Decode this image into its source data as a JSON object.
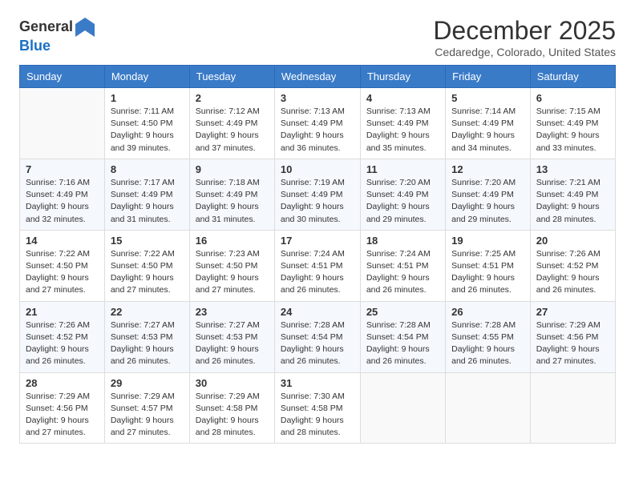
{
  "header": {
    "logo_line1": "General",
    "logo_line2": "Blue",
    "month_title": "December 2025",
    "location": "Cedaredge, Colorado, United States"
  },
  "weekdays": [
    "Sunday",
    "Monday",
    "Tuesday",
    "Wednesday",
    "Thursday",
    "Friday",
    "Saturday"
  ],
  "weeks": [
    [
      {
        "day": "",
        "sunrise": "",
        "sunset": "",
        "daylight": ""
      },
      {
        "day": "1",
        "sunrise": "7:11 AM",
        "sunset": "4:50 PM",
        "daylight": "9 hours and 39 minutes."
      },
      {
        "day": "2",
        "sunrise": "7:12 AM",
        "sunset": "4:49 PM",
        "daylight": "9 hours and 37 minutes."
      },
      {
        "day": "3",
        "sunrise": "7:13 AM",
        "sunset": "4:49 PM",
        "daylight": "9 hours and 36 minutes."
      },
      {
        "day": "4",
        "sunrise": "7:13 AM",
        "sunset": "4:49 PM",
        "daylight": "9 hours and 35 minutes."
      },
      {
        "day": "5",
        "sunrise": "7:14 AM",
        "sunset": "4:49 PM",
        "daylight": "9 hours and 34 minutes."
      },
      {
        "day": "6",
        "sunrise": "7:15 AM",
        "sunset": "4:49 PM",
        "daylight": "9 hours and 33 minutes."
      }
    ],
    [
      {
        "day": "7",
        "sunrise": "7:16 AM",
        "sunset": "4:49 PM",
        "daylight": "9 hours and 32 minutes."
      },
      {
        "day": "8",
        "sunrise": "7:17 AM",
        "sunset": "4:49 PM",
        "daylight": "9 hours and 31 minutes."
      },
      {
        "day": "9",
        "sunrise": "7:18 AM",
        "sunset": "4:49 PM",
        "daylight": "9 hours and 31 minutes."
      },
      {
        "day": "10",
        "sunrise": "7:19 AM",
        "sunset": "4:49 PM",
        "daylight": "9 hours and 30 minutes."
      },
      {
        "day": "11",
        "sunrise": "7:20 AM",
        "sunset": "4:49 PM",
        "daylight": "9 hours and 29 minutes."
      },
      {
        "day": "12",
        "sunrise": "7:20 AM",
        "sunset": "4:49 PM",
        "daylight": "9 hours and 29 minutes."
      },
      {
        "day": "13",
        "sunrise": "7:21 AM",
        "sunset": "4:49 PM",
        "daylight": "9 hours and 28 minutes."
      }
    ],
    [
      {
        "day": "14",
        "sunrise": "7:22 AM",
        "sunset": "4:50 PM",
        "daylight": "9 hours and 27 minutes."
      },
      {
        "day": "15",
        "sunrise": "7:22 AM",
        "sunset": "4:50 PM",
        "daylight": "9 hours and 27 minutes."
      },
      {
        "day": "16",
        "sunrise": "7:23 AM",
        "sunset": "4:50 PM",
        "daylight": "9 hours and 27 minutes."
      },
      {
        "day": "17",
        "sunrise": "7:24 AM",
        "sunset": "4:51 PM",
        "daylight": "9 hours and 26 minutes."
      },
      {
        "day": "18",
        "sunrise": "7:24 AM",
        "sunset": "4:51 PM",
        "daylight": "9 hours and 26 minutes."
      },
      {
        "day": "19",
        "sunrise": "7:25 AM",
        "sunset": "4:51 PM",
        "daylight": "9 hours and 26 minutes."
      },
      {
        "day": "20",
        "sunrise": "7:26 AM",
        "sunset": "4:52 PM",
        "daylight": "9 hours and 26 minutes."
      }
    ],
    [
      {
        "day": "21",
        "sunrise": "7:26 AM",
        "sunset": "4:52 PM",
        "daylight": "9 hours and 26 minutes."
      },
      {
        "day": "22",
        "sunrise": "7:27 AM",
        "sunset": "4:53 PM",
        "daylight": "9 hours and 26 minutes."
      },
      {
        "day": "23",
        "sunrise": "7:27 AM",
        "sunset": "4:53 PM",
        "daylight": "9 hours and 26 minutes."
      },
      {
        "day": "24",
        "sunrise": "7:28 AM",
        "sunset": "4:54 PM",
        "daylight": "9 hours and 26 minutes."
      },
      {
        "day": "25",
        "sunrise": "7:28 AM",
        "sunset": "4:54 PM",
        "daylight": "9 hours and 26 minutes."
      },
      {
        "day": "26",
        "sunrise": "7:28 AM",
        "sunset": "4:55 PM",
        "daylight": "9 hours and 26 minutes."
      },
      {
        "day": "27",
        "sunrise": "7:29 AM",
        "sunset": "4:56 PM",
        "daylight": "9 hours and 27 minutes."
      }
    ],
    [
      {
        "day": "28",
        "sunrise": "7:29 AM",
        "sunset": "4:56 PM",
        "daylight": "9 hours and 27 minutes."
      },
      {
        "day": "29",
        "sunrise": "7:29 AM",
        "sunset": "4:57 PM",
        "daylight": "9 hours and 27 minutes."
      },
      {
        "day": "30",
        "sunrise": "7:29 AM",
        "sunset": "4:58 PM",
        "daylight": "9 hours and 28 minutes."
      },
      {
        "day": "31",
        "sunrise": "7:30 AM",
        "sunset": "4:58 PM",
        "daylight": "9 hours and 28 minutes."
      },
      {
        "day": "",
        "sunrise": "",
        "sunset": "",
        "daylight": ""
      },
      {
        "day": "",
        "sunrise": "",
        "sunset": "",
        "daylight": ""
      },
      {
        "day": "",
        "sunrise": "",
        "sunset": "",
        "daylight": ""
      }
    ]
  ],
  "labels": {
    "sunrise_prefix": "Sunrise: ",
    "sunset_prefix": "Sunset: ",
    "daylight_prefix": "Daylight: "
  }
}
